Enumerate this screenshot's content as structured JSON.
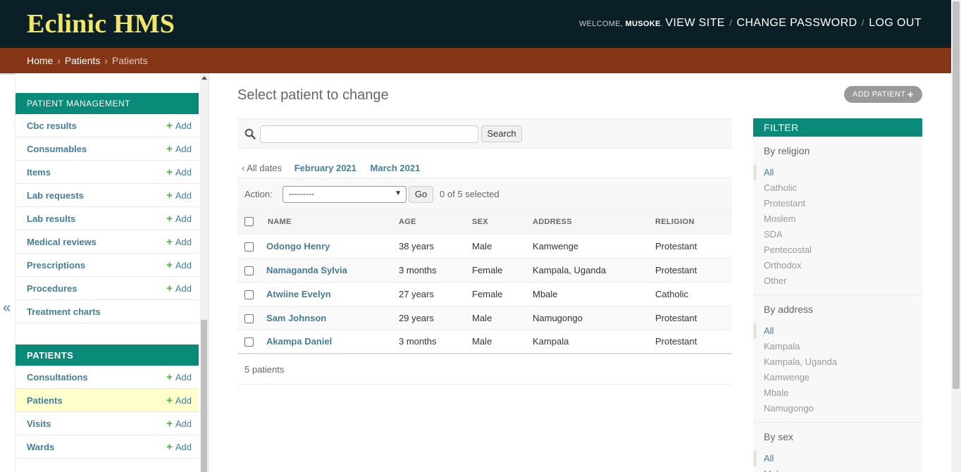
{
  "header": {
    "brand": "Eclinic HMS",
    "welcome": "WELCOME,",
    "username": "MUSOKE",
    "view_site": "VIEW SITE",
    "change_password": "CHANGE PASSWORD",
    "log_out": "LOG OUT",
    "separator": "/"
  },
  "breadcrumbs": {
    "home": "Home",
    "app": "Patients",
    "current": "Patients",
    "sep": "›"
  },
  "sidebar": {
    "toggle": "«",
    "modules": [
      {
        "caption": "PATIENT MANAGEMENT",
        "models": [
          {
            "name": "Cbc results",
            "add": "Add"
          },
          {
            "name": "Consumables",
            "add": "Add"
          },
          {
            "name": "Items",
            "add": "Add"
          },
          {
            "name": "Lab requests",
            "add": "Add"
          },
          {
            "name": "Lab results",
            "add": "Add"
          },
          {
            "name": "Medical reviews",
            "add": "Add"
          },
          {
            "name": "Prescriptions",
            "add": "Add"
          },
          {
            "name": "Procedures",
            "add": "Add"
          },
          {
            "name": "Treatment charts",
            "add": ""
          }
        ]
      },
      {
        "caption": "PATIENTS",
        "models": [
          {
            "name": "Consultations",
            "add": "Add"
          },
          {
            "name": "Patients",
            "add": "Add",
            "active": true
          },
          {
            "name": "Visits",
            "add": "Add"
          },
          {
            "name": "Wards",
            "add": "Add"
          }
        ]
      }
    ]
  },
  "content": {
    "title": "Select patient to change",
    "add_button": "ADD PATIENT",
    "search_button": "Search",
    "search_value": "",
    "date_hierarchy": {
      "back": "‹ All dates",
      "links": [
        "February 2021",
        "March 2021"
      ]
    },
    "actions": {
      "label": "Action:",
      "selected_option": "---------",
      "go": "Go",
      "counter": "0 of 5 selected"
    },
    "table": {
      "headers": [
        "NAME",
        "AGE",
        "SEX",
        "ADDRESS",
        "RELIGION"
      ],
      "rows": [
        [
          "Odongo Henry",
          "38 years",
          "Male",
          "Kamwenge",
          "Protestant"
        ],
        [
          "Namaganda Sylvia",
          "3 months",
          "Female",
          "Kampala, Uganda",
          "Protestant"
        ],
        [
          "Atwiine Evelyn",
          "27 years",
          "Female",
          "Mbale",
          "Catholic"
        ],
        [
          "Sam Johnson",
          "29 years",
          "Male",
          "Namugongo",
          "Protestant"
        ],
        [
          "Akampa Daniel",
          "3 months",
          "Male",
          "Kampala",
          "Protestant"
        ]
      ]
    },
    "paginator": "5 patients"
  },
  "filter": {
    "title": "FILTER",
    "groups": [
      {
        "title": "By religion",
        "options": [
          "All",
          "Catholic",
          "Protestant",
          "Moslem",
          "SDA",
          "Pentecostal",
          "Orthodox",
          "Other"
        ]
      },
      {
        "title": "By address",
        "options": [
          "All",
          "Kampala",
          "Kampala, Uganda",
          "Kamwenge",
          "Mbale",
          "Namugongo"
        ]
      },
      {
        "title": "By sex",
        "options": [
          "All",
          "Male"
        ]
      }
    ]
  },
  "colors": {
    "header_bg": "#0b2026",
    "brand": "#f3e568",
    "breadcrumbs_bg": "#853616",
    "module_caption_bg": "#0a8a78",
    "link": "#447e9b",
    "add_plus": "#4ab13a",
    "active_row": "#ffffcc"
  }
}
